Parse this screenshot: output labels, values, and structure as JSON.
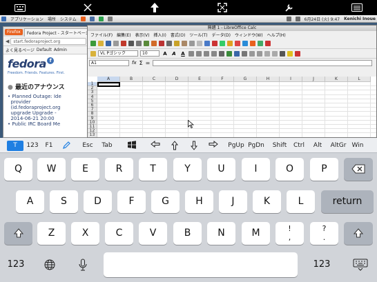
{
  "toolbar": {
    "keyboard_icon": "keyboard-icon",
    "close_icon": "close-icon",
    "upload_icon": "upload-arrow-icon",
    "fullscreen_icon": "fullscreen-icon",
    "settings_icon": "wrench-icon",
    "menu_icon": "menu-icon"
  },
  "sys_panel": {
    "applications": "アプリケーション",
    "places": "場所",
    "system": "システム",
    "datetime": "6月24日 (火) 9:47",
    "user": "Kenichi Inoue"
  },
  "firefox": {
    "menu_label": "Firefox",
    "tab_label": "Fedora Project - スタートページ",
    "url": "start.fedoraproject.org",
    "bookmarks": [
      "よく見るページ",
      "Default",
      "Admin"
    ],
    "logo_text": "fedora",
    "tagline": "Freedom. Friends. Features. First.",
    "announcements_title": "最近のアナウンス",
    "announcements": [
      "Planned Outage: Ide",
      "provider",
      "(id.fedoraproject.org",
      "upgrade Upgrade -",
      "2014-06-21 20:00",
      "Public IRC Board Me"
    ]
  },
  "calc": {
    "title": "無題 1 - LibreOffice Calc",
    "menu": [
      "ファイル(F)",
      "編集(E)",
      "表示(V)",
      "挿入(I)",
      "書式(O)",
      "ツール(T)",
      "データ(D)",
      "ウィンドウ(W)",
      "ヘルプ(H)"
    ],
    "font_name": "VL Pゴシック",
    "font_size": "10",
    "cell_ref": "A1",
    "columns": [
      "A",
      "B",
      "C",
      "D",
      "E",
      "F",
      "G",
      "H",
      "I",
      "J",
      "K",
      "L"
    ],
    "rows": [
      "1",
      "2",
      "3",
      "4",
      "5",
      "6",
      "7",
      "8",
      "9",
      "10",
      "11",
      "12",
      "13"
    ],
    "sum_symbol": "Σ",
    "fx_symbol": "fx",
    "equals_symbol": "="
  },
  "accessory_bar": {
    "modes": [
      "T",
      "123",
      "F1"
    ],
    "keys": [
      "Esc",
      "Tab",
      "",
      "←",
      "↑",
      "↓",
      "→",
      "PgUp",
      "PgDn",
      "Shift",
      "Ctrl",
      "Alt",
      "AltGr",
      "Win"
    ]
  },
  "keyboard": {
    "row1": [
      "Q",
      "W",
      "E",
      "R",
      "T",
      "Y",
      "U",
      "I",
      "O",
      "P"
    ],
    "row2": [
      "A",
      "S",
      "D",
      "F",
      "G",
      "H",
      "J",
      "K",
      "L"
    ],
    "row3": [
      "Z",
      "X",
      "C",
      "V",
      "B",
      "N",
      "M"
    ],
    "exclam_top": "!",
    "exclam_bottom": ",",
    "question_top": "?",
    "question_bottom": ".",
    "return_label": "return",
    "num_label": "123",
    "num_label_right": "123"
  },
  "colors": {
    "accent": "#1f7fe2",
    "keyboard_bg": "#d1d4d9",
    "fedora_blue": "#294172"
  }
}
